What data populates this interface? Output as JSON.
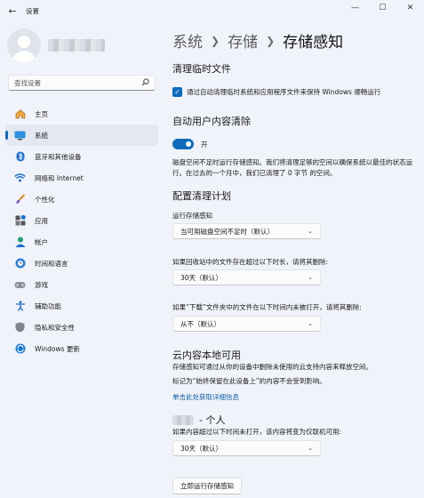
{
  "window": {
    "title": "设置",
    "back_icon": "←",
    "minimize_icon": "—",
    "maximize_icon": "☐",
    "close_icon": "✕"
  },
  "sidebar": {
    "search_placeholder": "查找设置",
    "items": [
      {
        "label": "主页",
        "icon": "home-icon",
        "active": false
      },
      {
        "label": "系统",
        "icon": "system-icon",
        "active": true
      },
      {
        "label": "蓝牙和其他设备",
        "icon": "bluetooth-icon",
        "active": false
      },
      {
        "label": "网络和 Internet",
        "icon": "wifi-icon",
        "active": false
      },
      {
        "label": "个性化",
        "icon": "brush-icon",
        "active": false
      },
      {
        "label": "应用",
        "icon": "apps-icon",
        "active": false
      },
      {
        "label": "帐户",
        "icon": "account-icon",
        "active": false
      },
      {
        "label": "时间和语言",
        "icon": "globe-clock-icon",
        "active": false
      },
      {
        "label": "游戏",
        "icon": "gamepad-icon",
        "active": false
      },
      {
        "label": "辅助功能",
        "icon": "accessibility-icon",
        "active": false
      },
      {
        "label": "隐私和安全性",
        "icon": "shield-icon",
        "active": false
      },
      {
        "label": "Windows 更新",
        "icon": "update-icon",
        "active": false
      }
    ]
  },
  "breadcrumb": [
    "系统",
    "存储",
    "存储感知"
  ],
  "main": {
    "temp_heading": "清理临时文件",
    "temp_checkbox_label": "通过自动清理临时系统和应用程序文件来保持 Windows 顺畅运行",
    "auto_heading": "自动用户内容清除",
    "toggle_label": "开",
    "auto_description": "磁盘空间不足时运行存储感知。我们将清理足够的空间以确保系统以最佳的状态运行。在过去的一个月中，我们已清理了 0 字节 的空间。",
    "schedule_heading": "配置清理计划",
    "run_label": "运行存储感知",
    "run_value": "当可用磁盘空间不足时（默认）",
    "recycle_label": "如果回收站中的文件存在超过以下时长，请将其删除:",
    "recycle_value": "30天（默认）",
    "downloads_label": "如果“下载”文件夹中的文件在以下时间内未被打开，请将其删除:",
    "downloads_value": "从不（默认）",
    "cloud_heading": "云内容本地可用",
    "cloud_description": "存储感知可通过从你的设备中删除未使用的云支持内容来释放空间。",
    "cloud_note": "标记为“始终保留在此设备上”的内容不会受到影响。",
    "learn_more": "单击此处获取详细信息",
    "cloud_user_suffix": "- 个人",
    "cloud_user_label": "如果内容超过以下时间未打开，该内容将变为仅联机可用:",
    "cloud_user_value": "30天（默认）",
    "run_now_button": "立即运行存储感知"
  },
  "colors": {
    "accent": "#0f6cbd",
    "background": "#f0f3f9"
  }
}
